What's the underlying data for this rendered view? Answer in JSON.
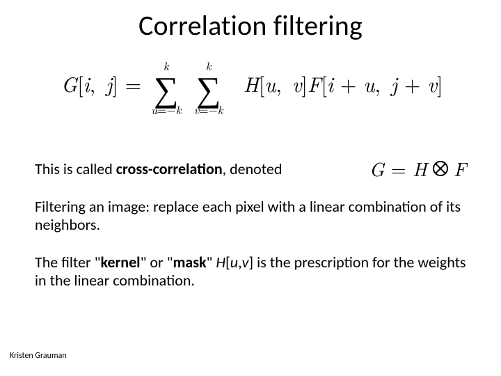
{
  "title": "Correlation filtering",
  "equation": {
    "lhs_G": "G",
    "lbr": "[",
    "i": "i",
    "comma": ",",
    "j": "j",
    "rbr": "]",
    "eq": " = ",
    "sum1": {
      "top": "k",
      "sigma": "∑",
      "bot_lhs": "u",
      "bot_eq": "=",
      "bot_neg": "−",
      "bot_rhs": "k"
    },
    "sum2": {
      "top": "k",
      "sigma": "∑",
      "bot_lhs": "v",
      "bot_eq": "=",
      "bot_neg": "−",
      "bot_rhs": "k"
    },
    "H": "H",
    "u": "u",
    "v": "v",
    "F": "F",
    "plus": " + "
  },
  "cc": {
    "pre": "This is called ",
    "term": "cross-correlation",
    "post": ", denoted",
    "eq_G": "G",
    "eq_eq": " = ",
    "eq_H": "H",
    "eq_F": "F"
  },
  "para1": "Filtering an image: replace each pixel with a linear combination of its neighbors.",
  "para2_a": "The filter \"",
  "para2_kernel": "kernel",
  "para2_b": "\" or \"",
  "para2_mask": "mask",
  "para2_c": "\" ",
  "para2_H": "H",
  "para2_d": "[",
  "para2_u": "u",
  "para2_e": ",",
  "para2_v": "v",
  "para2_f": "] is the prescription for the weights in the linear combination.",
  "attribution": "Kristen Grauman"
}
